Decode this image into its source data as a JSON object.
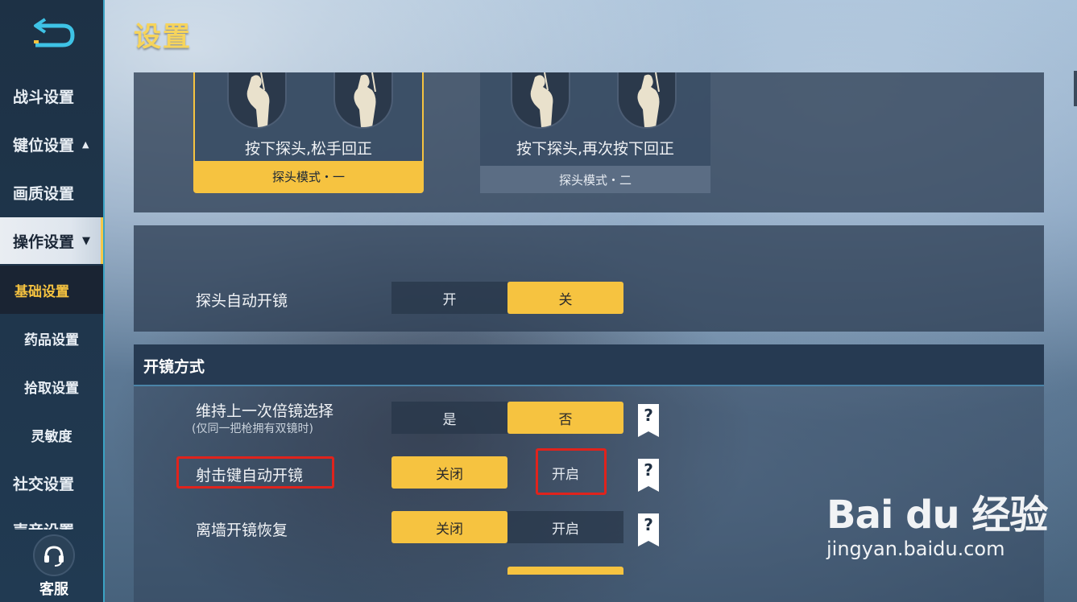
{
  "page_title": "设置",
  "sidebar": {
    "items": [
      {
        "label": "战斗设置"
      },
      {
        "label": "键位设置",
        "arrow": "▲"
      },
      {
        "label": "画质设置"
      },
      {
        "label": "操作设置",
        "arrow": "▼"
      },
      {
        "label": "基础设置"
      },
      {
        "label": "药品设置"
      },
      {
        "label": "拾取设置"
      },
      {
        "label": "灵敏度"
      },
      {
        "label": "社交设置"
      },
      {
        "label": "声音设置"
      }
    ],
    "service_label": "客服"
  },
  "peek_modes": [
    {
      "description": "按下探头,松手回正",
      "tab": "探头模式・一",
      "selected": true
    },
    {
      "description": "按下探头,再次按下回正",
      "tab": "探头模式・二",
      "selected": false
    }
  ],
  "peek_auto_scope": {
    "label": "探头自动开镜",
    "options": [
      "开",
      "关"
    ],
    "selected": "关"
  },
  "scope_section": {
    "title": "开镜方式",
    "rows": [
      {
        "label": "维持上一次倍镜选择",
        "sublabel": "(仅同一把枪拥有双镜时)",
        "options": [
          "是",
          "否"
        ],
        "selected": "否",
        "help": "?"
      },
      {
        "label": "射击键自动开镜",
        "options": [
          "关闭",
          "开启"
        ],
        "selected": "关闭",
        "help": "?"
      },
      {
        "label": "离墙开镜恢复",
        "options": [
          "关闭",
          "开启"
        ],
        "selected": "关闭",
        "help": "?"
      }
    ]
  },
  "watermark": {
    "logo": "Bai du 经验",
    "url": "jingyan.baidu.com"
  },
  "colors": {
    "accent": "#f6c340",
    "highlight_box": "#e0231c",
    "sidebar": "#1d3145"
  }
}
